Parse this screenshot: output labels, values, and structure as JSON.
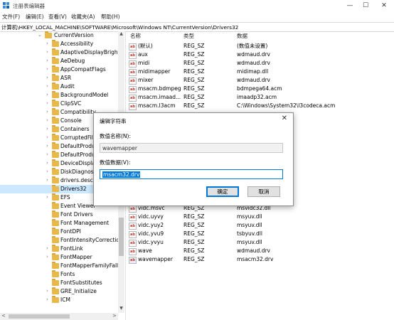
{
  "window": {
    "title": "注册表编辑器",
    "controls": {
      "minimize": "—",
      "maximize": "☐",
      "close": "✕"
    }
  },
  "menu": [
    "文件(F)",
    "编辑(E)",
    "查看(V)",
    "收藏夹(A)",
    "帮助(H)"
  ],
  "address": "计算机\\HKEY_LOCAL_MACHINE\\SOFTWARE\\Microsoft\\Windows NT\\CurrentVersion\\Drivers32",
  "tree": {
    "items": [
      {
        "label": "CurrentVersion",
        "expanded": true
      },
      {
        "label": "Accessibility"
      },
      {
        "label": "AdaptiveDisplayBright"
      },
      {
        "label": "AeDebug"
      },
      {
        "label": "AppCompatFlags"
      },
      {
        "label": "ASR"
      },
      {
        "label": "Audit"
      },
      {
        "label": "BackgroundModel"
      },
      {
        "label": "ClipSVC"
      },
      {
        "label": "Compatibility"
      },
      {
        "label": "Console"
      },
      {
        "label": "Containers"
      },
      {
        "label": "CorruptedFil"
      },
      {
        "label": "DefaultProdu"
      },
      {
        "label": "DefaultProdu"
      },
      {
        "label": "DeviceDispla"
      },
      {
        "label": "DiskDiagnos"
      },
      {
        "label": "drivers.desc"
      },
      {
        "label": "Drivers32",
        "selected": true
      },
      {
        "label": "EFS"
      },
      {
        "label": "Event Viewer"
      },
      {
        "label": "Font Drivers"
      },
      {
        "label": "Font Management"
      },
      {
        "label": "FontDPI"
      },
      {
        "label": "FontIntensityCorrectio"
      },
      {
        "label": "FontLink"
      },
      {
        "label": "FontMapper"
      },
      {
        "label": "FontMapperFamilyFall"
      },
      {
        "label": "Fonts"
      },
      {
        "label": "FontSubstitutes"
      },
      {
        "label": "GRE_Initialize"
      },
      {
        "label": "ICM"
      }
    ]
  },
  "list": {
    "headers": {
      "name": "名称",
      "type": "类型",
      "data": "数据"
    },
    "rows": [
      {
        "name": "(默认)",
        "type": "REG_SZ",
        "data": "(数值未设置)"
      },
      {
        "name": "aux",
        "type": "REG_SZ",
        "data": "wdmaud.drv"
      },
      {
        "name": "midi",
        "type": "REG_SZ",
        "data": "wdmaud.drv"
      },
      {
        "name": "midimapper",
        "type": "REG_SZ",
        "data": "midimap.dll"
      },
      {
        "name": "mixer",
        "type": "REG_SZ",
        "data": "wdmaud.drv"
      },
      {
        "name": "msacm.bdmpeg",
        "type": "REG_SZ",
        "data": "bdmpega64.acm"
      },
      {
        "name": "msacm.imaad...",
        "type": "REG_SZ",
        "data": "imaadp32.acm"
      },
      {
        "name": "msacm.l3acm",
        "type": "REG_SZ",
        "data": "C:\\Windows\\System32\\l3codeca.acm"
      },
      {
        "name": "vidc.msvc",
        "type": "REG_SZ",
        "data": "msvidc32.dll"
      },
      {
        "name": "vidc.uyvy",
        "type": "REG_SZ",
        "data": "msyuv.dll"
      },
      {
        "name": "vidc.yuy2",
        "type": "REG_SZ",
        "data": "msyuv.dll"
      },
      {
        "name": "vidc.yvu9",
        "type": "REG_SZ",
        "data": "tsbyuv.dll"
      },
      {
        "name": "vidc.yvyu",
        "type": "REG_SZ",
        "data": "msyuv.dll"
      },
      {
        "name": "wave",
        "type": "REG_SZ",
        "data": "wdmaud.drv"
      },
      {
        "name": "wavemapper",
        "type": "REG_SZ",
        "data": "msacm32.drv"
      }
    ]
  },
  "dialog": {
    "title": "编辑字符串",
    "close": "✕",
    "name_label": "数值名称(N):",
    "name_value": "wavemapper",
    "data_label": "数值数据(V):",
    "data_value": "msacm32.drv",
    "ok": "确定",
    "cancel": "取消"
  },
  "scroll": {
    "up": "▲",
    "down": "▼",
    "left": "<",
    "right": ">"
  },
  "colors": {
    "selection": "#cce8ff",
    "accent": "#0078d7",
    "folder": "#e8b84a"
  }
}
